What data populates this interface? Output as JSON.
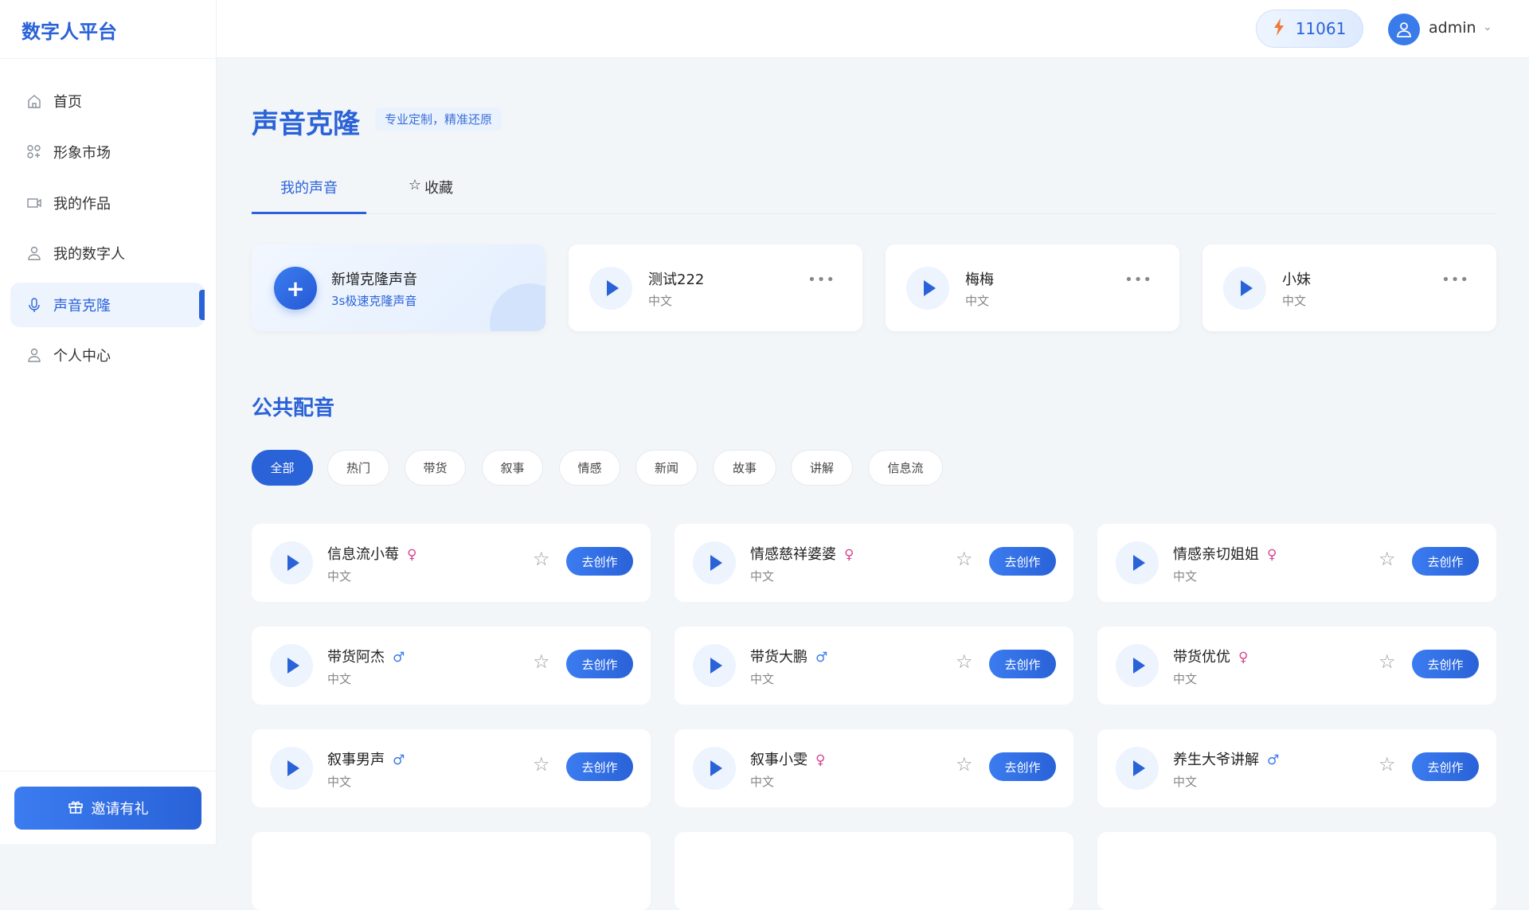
{
  "app": {
    "logo": "数字人平台"
  },
  "sidebar": {
    "items": [
      {
        "label": "首页",
        "icon": "home-icon"
      },
      {
        "label": "形象市场",
        "icon": "grid-icon"
      },
      {
        "label": "我的作品",
        "icon": "video-icon"
      },
      {
        "label": "我的数字人",
        "icon": "user-icon"
      },
      {
        "label": "声音克隆",
        "icon": "mic-icon",
        "active": true
      },
      {
        "label": "个人中心",
        "icon": "user-icon"
      }
    ],
    "invite": "邀请有礼"
  },
  "header": {
    "credits": "11061",
    "username": "admin"
  },
  "page": {
    "title": "声音克隆",
    "subtitle": "专业定制，精准还原",
    "tabs": [
      "我的声音",
      "收藏"
    ]
  },
  "my_voices": {
    "add": {
      "title": "新增克隆声音",
      "subtitle": "3s极速克隆声音"
    },
    "items": [
      {
        "name": "测试222",
        "lang": "中文"
      },
      {
        "name": "梅梅",
        "lang": "中文"
      },
      {
        "name": "小妹",
        "lang": "中文"
      }
    ],
    "more": "•••"
  },
  "public": {
    "title": "公共配音",
    "filters": [
      "全部",
      "热门",
      "带货",
      "叙事",
      "情感",
      "新闻",
      "故事",
      "讲解",
      "信息流"
    ],
    "action": "去创作",
    "voices": [
      {
        "name": "信息流小莓",
        "lang": "中文",
        "gender": "♀"
      },
      {
        "name": "情感慈祥婆婆",
        "lang": "中文",
        "gender": "♀"
      },
      {
        "name": "情感亲切姐姐",
        "lang": "中文",
        "gender": "♀"
      },
      {
        "name": "带货阿杰",
        "lang": "中文",
        "gender": "♂"
      },
      {
        "name": "带货大鹏",
        "lang": "中文",
        "gender": "♂"
      },
      {
        "name": "带货优优",
        "lang": "中文",
        "gender": "♀"
      },
      {
        "name": "叙事男声",
        "lang": "中文",
        "gender": "♂"
      },
      {
        "name": "叙事小雯",
        "lang": "中文",
        "gender": "♀"
      },
      {
        "name": "养生大爷讲解",
        "lang": "中文",
        "gender": "♂"
      }
    ]
  }
}
